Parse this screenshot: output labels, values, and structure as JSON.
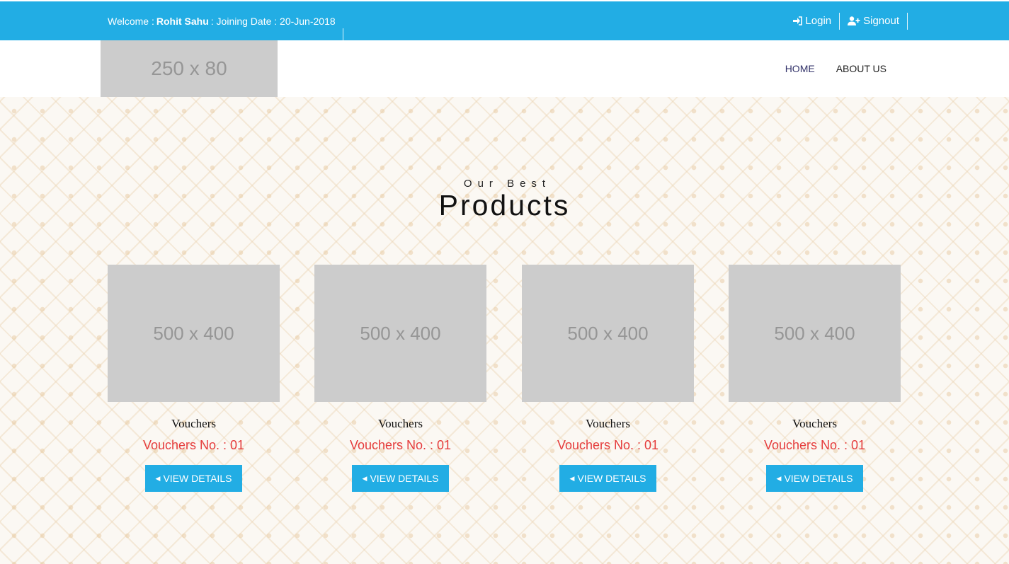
{
  "topbar": {
    "welcome_prefix": "Welcome :",
    "user_name": "Rohit Sahu",
    "joining_label": ": Joining Date : 20-Jun-2018",
    "login_label": "Login",
    "signout_label": "Signout",
    "color": "#22ade4"
  },
  "nav": {
    "logo_text": "250 x 80",
    "items": [
      {
        "label": "HOME",
        "active": true
      },
      {
        "label": "ABOUT US",
        "active": false
      }
    ]
  },
  "section": {
    "subtitle": "Our Best",
    "title": "Products"
  },
  "products": [
    {
      "image_text": "500 x 400",
      "title": "Vouchers",
      "number": "Vouchers No. : 01",
      "button": "VIEW DETAILS"
    },
    {
      "image_text": "500 x 400",
      "title": "Vouchers",
      "number": "Vouchers No. : 01",
      "button": "VIEW DETAILS"
    },
    {
      "image_text": "500 x 400",
      "title": "Vouchers",
      "number": "Vouchers No. : 01",
      "button": "VIEW DETAILS"
    },
    {
      "image_text": "500 x 400",
      "title": "Vouchers",
      "number": "Vouchers No. : 01",
      "button": "VIEW DETAILS"
    }
  ],
  "colors": {
    "accent": "#22ade4",
    "price_red": "#e53c3c",
    "placeholder": "#cccccc"
  }
}
